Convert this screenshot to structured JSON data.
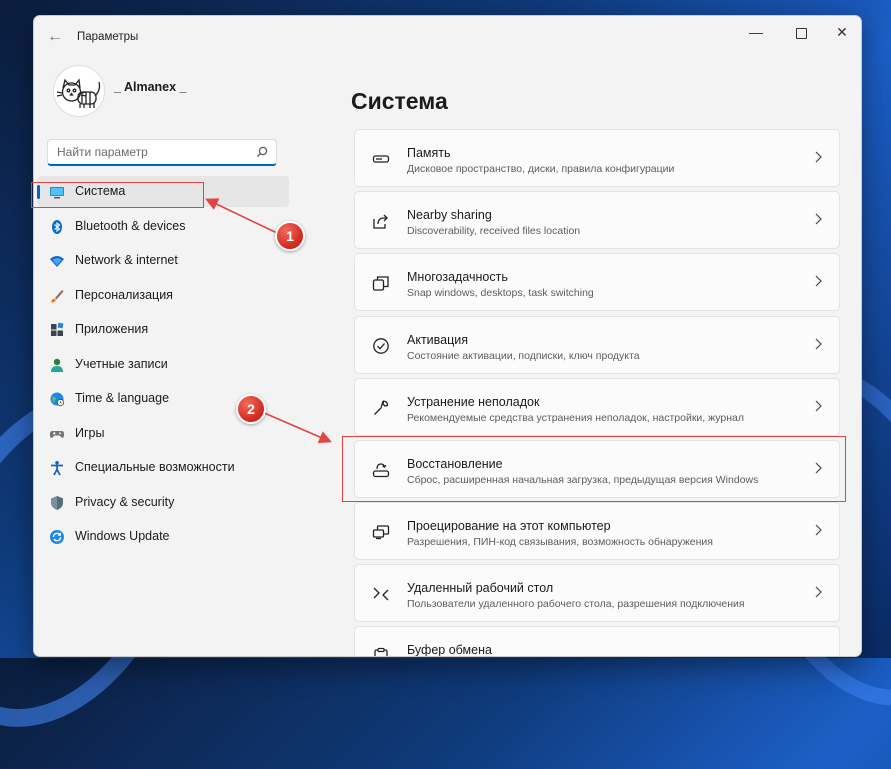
{
  "titlebar": {
    "back_glyph": "←",
    "title": "Параметры",
    "minimize_glyph": "—",
    "close_glyph": "✕"
  },
  "user": {
    "name": "_ Almanex _"
  },
  "search": {
    "placeholder": "Найти параметр",
    "value": ""
  },
  "sidebar": {
    "items": [
      {
        "label": "Система",
        "icon": "system-display-icon",
        "active": true
      },
      {
        "label": "Bluetooth & devices",
        "icon": "bluetooth-icon"
      },
      {
        "label": "Network & internet",
        "icon": "wifi-icon"
      },
      {
        "label": "Персонализация",
        "icon": "brush-icon"
      },
      {
        "label": "Приложения",
        "icon": "apps-icon"
      },
      {
        "label": "Учетные записи",
        "icon": "account-icon"
      },
      {
        "label": "Time & language",
        "icon": "globe-clock-icon"
      },
      {
        "label": "Игры",
        "icon": "gamepad-icon"
      },
      {
        "label": "Специальные возможности",
        "icon": "accessibility-icon"
      },
      {
        "label": "Privacy & security",
        "icon": "shield-icon"
      },
      {
        "label": "Windows Update",
        "icon": "update-icon"
      }
    ]
  },
  "main": {
    "title": "Система",
    "cards": [
      {
        "title": "Память",
        "desc": "Дисковое пространство, диски, правила конфигурации",
        "icon": "storage-icon"
      },
      {
        "title": "Nearby sharing",
        "desc": "Discoverability, received files location",
        "icon": "share-icon"
      },
      {
        "title": "Многозадачность",
        "desc": "Snap windows, desktops, task switching",
        "icon": "multitasking-icon"
      },
      {
        "title": "Активация",
        "desc": "Состояние активации, подписки, ключ продукта",
        "icon": "activation-check-icon"
      },
      {
        "title": "Устранение неполадок",
        "desc": "Рекомендуемые средства устранения неполадок, настройки, журнал",
        "icon": "wrench-icon"
      },
      {
        "title": "Восстановление",
        "desc": "Сброс, расширенная начальная загрузка, предыдущая версия Windows",
        "icon": "recovery-icon"
      },
      {
        "title": "Проецирование на этот компьютер",
        "desc": "Разрешения, ПИН-код связывания, возможность обнаружения",
        "icon": "projection-icon"
      },
      {
        "title": "Удаленный рабочий стол",
        "desc": "Пользователи удаленного рабочего стола, разрешения подключения",
        "icon": "remote-desktop-icon"
      },
      {
        "title": "Буфер обмена",
        "desc": "",
        "icon": "clipboard-icon"
      }
    ]
  },
  "annotations": {
    "badge1": "1",
    "badge2": "2",
    "color": "#e04444"
  },
  "colors": {
    "accent": "#0067c0",
    "annotation_red": "#e04444",
    "window_bg": "#f3f3f3",
    "card_bg": "#fbfbfb"
  }
}
